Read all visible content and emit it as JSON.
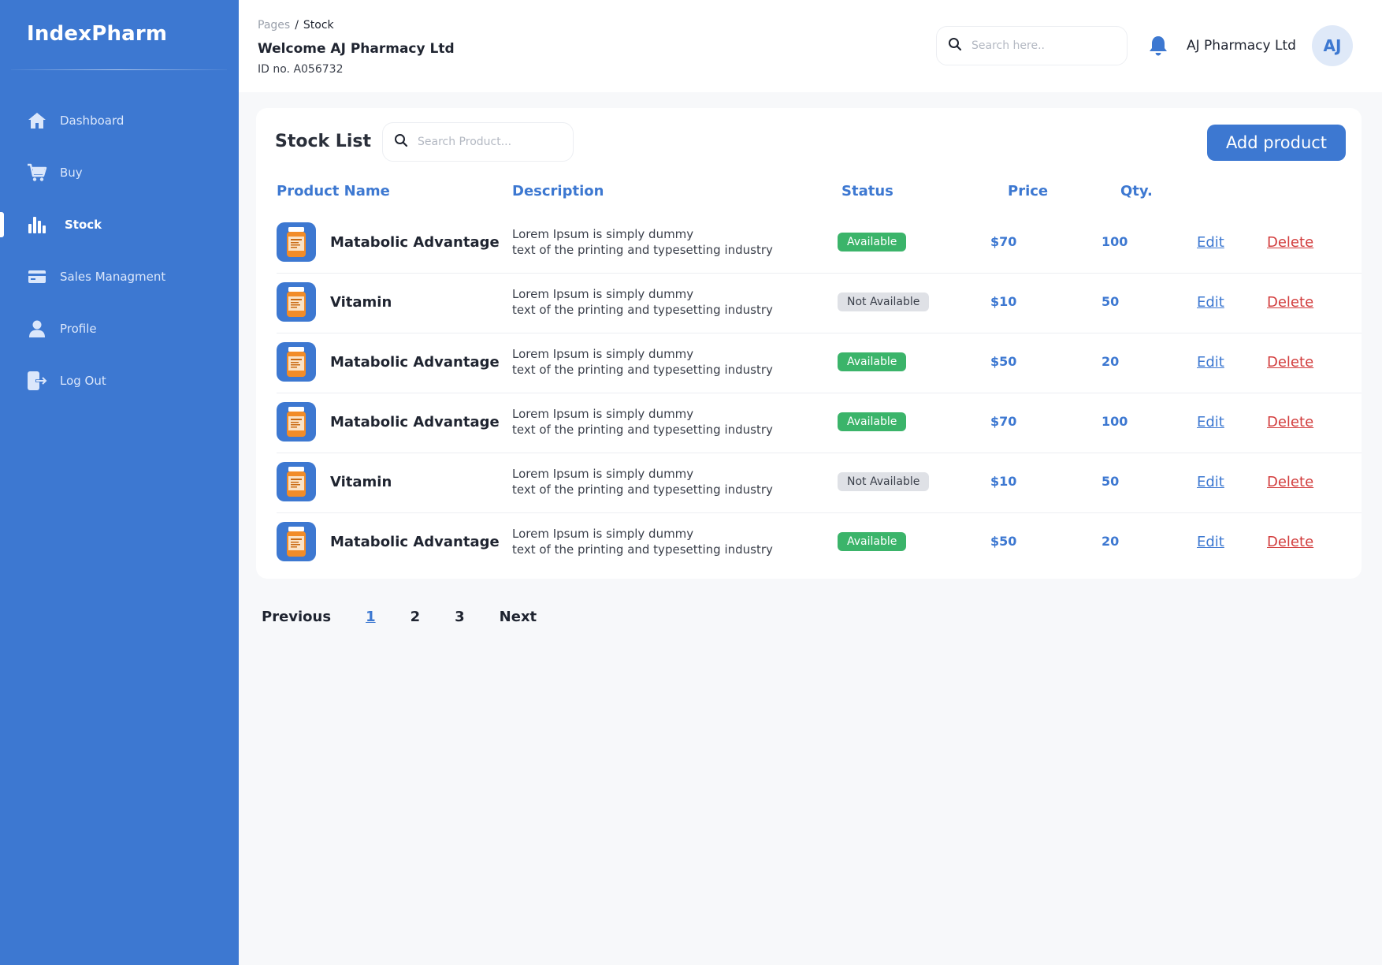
{
  "app": {
    "brand": "IndexPharm"
  },
  "sidebar": {
    "items": [
      {
        "label": "Dashboard",
        "icon": "home-icon",
        "active": false
      },
      {
        "label": "Buy",
        "icon": "cart-icon",
        "active": false
      },
      {
        "label": "Stock",
        "icon": "bar-chart-icon",
        "active": true
      },
      {
        "label": "Sales Managment",
        "icon": "card-icon",
        "active": false
      },
      {
        "label": "Profile",
        "icon": "user-icon",
        "active": false
      },
      {
        "label": "Log Out",
        "icon": "logout-icon",
        "active": false
      }
    ]
  },
  "header": {
    "breadcrumb_parent": "Pages",
    "breadcrumb_sep": "/",
    "breadcrumb_current": "Stock",
    "welcome": "Welcome AJ Pharmacy Ltd",
    "id_text": "ID no. A056732",
    "search_placeholder": "Search here..",
    "user_name": "AJ Pharmacy Ltd",
    "avatar_initials": "AJ"
  },
  "stock": {
    "title": "Stock List",
    "search_placeholder": "Search Product...",
    "add_button": "Add product",
    "columns": {
      "name": "Product Name",
      "description": "Description",
      "status": "Status",
      "price": "Price",
      "qty": "Qty."
    },
    "rows": [
      {
        "name": "Matabolic Advantage",
        "desc1": "Lorem Ipsum is simply dummy",
        "desc2": "text of the printing and typesetting industry",
        "status": "Available",
        "price": "$70",
        "qty": "100",
        "edit": "Edit",
        "delete": "Delete"
      },
      {
        "name": "Vitamin",
        "desc1": "Lorem Ipsum is simply dummy",
        "desc2": "text of the printing and typesetting industry",
        "status": "Not Available",
        "price": "$10",
        "qty": "50",
        "edit": "Edit",
        "delete": "Delete"
      },
      {
        "name": "Matabolic Advantage",
        "desc1": "Lorem Ipsum is simply dummy",
        "desc2": "text of the printing and typesetting industry",
        "status": "Available",
        "price": "$50",
        "qty": "20",
        "edit": "Edit",
        "delete": "Delete"
      },
      {
        "name": "Matabolic Advantage",
        "desc1": "Lorem Ipsum is simply dummy",
        "desc2": "text of the printing and typesetting industry",
        "status": "Available",
        "price": "$70",
        "qty": "100",
        "edit": "Edit",
        "delete": "Delete"
      },
      {
        "name": "Vitamin",
        "desc1": "Lorem Ipsum is simply dummy",
        "desc2": "text of the printing and typesetting industry",
        "status": "Not Available",
        "price": "$10",
        "qty": "50",
        "edit": "Edit",
        "delete": "Delete"
      },
      {
        "name": "Matabolic Advantage",
        "desc1": "Lorem Ipsum is simply dummy",
        "desc2": "text of the printing and typesetting industry",
        "status": "Available",
        "price": "$50",
        "qty": "20",
        "edit": "Edit",
        "delete": "Delete"
      }
    ]
  },
  "pagination": {
    "previous": "Previous",
    "pages": [
      "1",
      "2",
      "3"
    ],
    "current": "1",
    "next": "Next"
  },
  "colors": {
    "primary": "#3d78d1",
    "available": "#3bb46a",
    "unavailable": "#dfe1e6",
    "delete": "#d23c3c"
  }
}
